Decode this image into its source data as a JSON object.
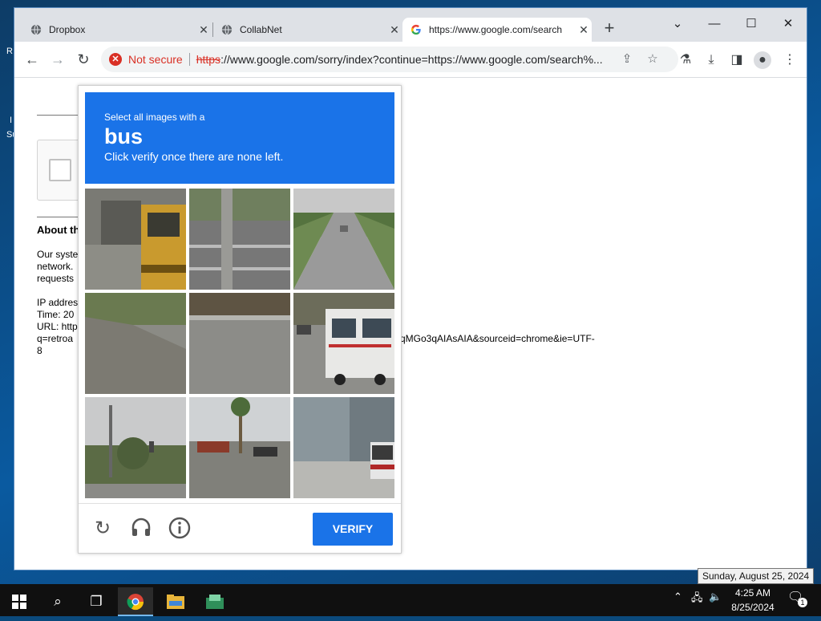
{
  "desktop": {
    "frag1": "R",
    "frag2": "I",
    "frag3": "Su"
  },
  "browser": {
    "tabs": [
      {
        "title": "Dropbox"
      },
      {
        "title": "CollabNet"
      },
      {
        "title": "https://www.google.com/search"
      }
    ],
    "omnibox": {
      "security_label": "Not secure",
      "scheme": "https",
      "url_rest": "://www.google.com/sorry/index?continue=https://www.google.com/search%..."
    }
  },
  "page": {
    "heading": "About th",
    "lines": [
      "Our syste",
      "network.",
      "requests"
    ],
    "ip": "IP addres",
    "time": "Time: 20",
    "url_line1": "URL: http",
    "url_line2": "q=retroa",
    "url_tail": "qMGo3qAIAsAIA&sourceid=chrome&ie=UTF-",
    "url_line3": "8"
  },
  "captcha": {
    "instruction_pre": "Select all images with a",
    "target": "bus",
    "instruction_post": "Click verify once there are none left.",
    "verify_label": "VERIFY",
    "tiles": [
      "school-bus-front",
      "street-pole",
      "road-car",
      "roadside-dirt",
      "road-curb",
      "white-bus",
      "traffic-light",
      "palm-street",
      "building-bus"
    ]
  },
  "taskbar": {
    "clock_time": "4:25 AM",
    "clock_date": "8/25/2024",
    "tooltip": "Sunday, August 25, 2024",
    "notification_count": "1"
  }
}
